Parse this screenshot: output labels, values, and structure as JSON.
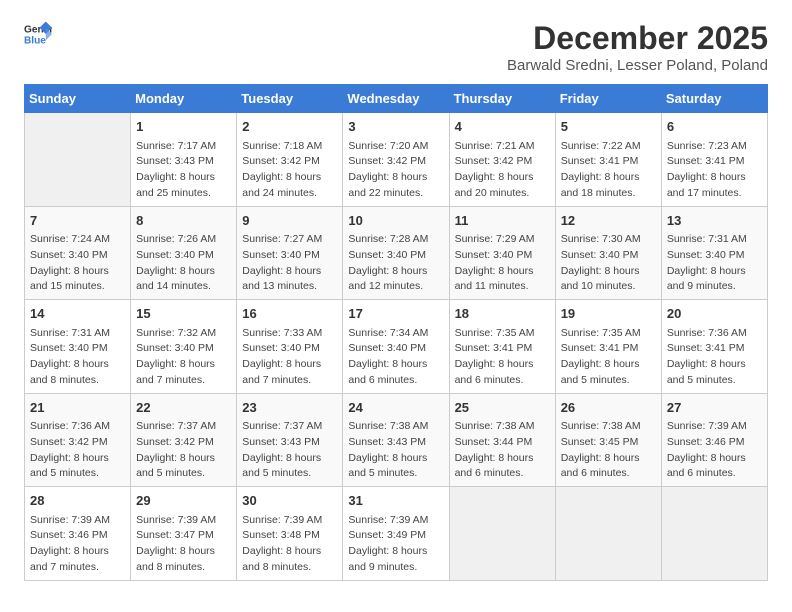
{
  "header": {
    "logo_general": "General",
    "logo_blue": "Blue",
    "title": "December 2025",
    "subtitle": "Barwald Sredni, Lesser Poland, Poland"
  },
  "weekdays": [
    "Sunday",
    "Monday",
    "Tuesday",
    "Wednesday",
    "Thursday",
    "Friday",
    "Saturday"
  ],
  "weeks": [
    [
      {
        "day": "",
        "sunrise": "",
        "sunset": "",
        "daylight": ""
      },
      {
        "day": "1",
        "sunrise": "Sunrise: 7:17 AM",
        "sunset": "Sunset: 3:43 PM",
        "daylight": "Daylight: 8 hours and 25 minutes."
      },
      {
        "day": "2",
        "sunrise": "Sunrise: 7:18 AM",
        "sunset": "Sunset: 3:42 PM",
        "daylight": "Daylight: 8 hours and 24 minutes."
      },
      {
        "day": "3",
        "sunrise": "Sunrise: 7:20 AM",
        "sunset": "Sunset: 3:42 PM",
        "daylight": "Daylight: 8 hours and 22 minutes."
      },
      {
        "day": "4",
        "sunrise": "Sunrise: 7:21 AM",
        "sunset": "Sunset: 3:42 PM",
        "daylight": "Daylight: 8 hours and 20 minutes."
      },
      {
        "day": "5",
        "sunrise": "Sunrise: 7:22 AM",
        "sunset": "Sunset: 3:41 PM",
        "daylight": "Daylight: 8 hours and 18 minutes."
      },
      {
        "day": "6",
        "sunrise": "Sunrise: 7:23 AM",
        "sunset": "Sunset: 3:41 PM",
        "daylight": "Daylight: 8 hours and 17 minutes."
      }
    ],
    [
      {
        "day": "7",
        "sunrise": "Sunrise: 7:24 AM",
        "sunset": "Sunset: 3:40 PM",
        "daylight": "Daylight: 8 hours and 15 minutes."
      },
      {
        "day": "8",
        "sunrise": "Sunrise: 7:26 AM",
        "sunset": "Sunset: 3:40 PM",
        "daylight": "Daylight: 8 hours and 14 minutes."
      },
      {
        "day": "9",
        "sunrise": "Sunrise: 7:27 AM",
        "sunset": "Sunset: 3:40 PM",
        "daylight": "Daylight: 8 hours and 13 minutes."
      },
      {
        "day": "10",
        "sunrise": "Sunrise: 7:28 AM",
        "sunset": "Sunset: 3:40 PM",
        "daylight": "Daylight: 8 hours and 12 minutes."
      },
      {
        "day": "11",
        "sunrise": "Sunrise: 7:29 AM",
        "sunset": "Sunset: 3:40 PM",
        "daylight": "Daylight: 8 hours and 11 minutes."
      },
      {
        "day": "12",
        "sunrise": "Sunrise: 7:30 AM",
        "sunset": "Sunset: 3:40 PM",
        "daylight": "Daylight: 8 hours and 10 minutes."
      },
      {
        "day": "13",
        "sunrise": "Sunrise: 7:31 AM",
        "sunset": "Sunset: 3:40 PM",
        "daylight": "Daylight: 8 hours and 9 minutes."
      }
    ],
    [
      {
        "day": "14",
        "sunrise": "Sunrise: 7:31 AM",
        "sunset": "Sunset: 3:40 PM",
        "daylight": "Daylight: 8 hours and 8 minutes."
      },
      {
        "day": "15",
        "sunrise": "Sunrise: 7:32 AM",
        "sunset": "Sunset: 3:40 PM",
        "daylight": "Daylight: 8 hours and 7 minutes."
      },
      {
        "day": "16",
        "sunrise": "Sunrise: 7:33 AM",
        "sunset": "Sunset: 3:40 PM",
        "daylight": "Daylight: 8 hours and 7 minutes."
      },
      {
        "day": "17",
        "sunrise": "Sunrise: 7:34 AM",
        "sunset": "Sunset: 3:40 PM",
        "daylight": "Daylight: 8 hours and 6 minutes."
      },
      {
        "day": "18",
        "sunrise": "Sunrise: 7:35 AM",
        "sunset": "Sunset: 3:41 PM",
        "daylight": "Daylight: 8 hours and 6 minutes."
      },
      {
        "day": "19",
        "sunrise": "Sunrise: 7:35 AM",
        "sunset": "Sunset: 3:41 PM",
        "daylight": "Daylight: 8 hours and 5 minutes."
      },
      {
        "day": "20",
        "sunrise": "Sunrise: 7:36 AM",
        "sunset": "Sunset: 3:41 PM",
        "daylight": "Daylight: 8 hours and 5 minutes."
      }
    ],
    [
      {
        "day": "21",
        "sunrise": "Sunrise: 7:36 AM",
        "sunset": "Sunset: 3:42 PM",
        "daylight": "Daylight: 8 hours and 5 minutes."
      },
      {
        "day": "22",
        "sunrise": "Sunrise: 7:37 AM",
        "sunset": "Sunset: 3:42 PM",
        "daylight": "Daylight: 8 hours and 5 minutes."
      },
      {
        "day": "23",
        "sunrise": "Sunrise: 7:37 AM",
        "sunset": "Sunset: 3:43 PM",
        "daylight": "Daylight: 8 hours and 5 minutes."
      },
      {
        "day": "24",
        "sunrise": "Sunrise: 7:38 AM",
        "sunset": "Sunset: 3:43 PM",
        "daylight": "Daylight: 8 hours and 5 minutes."
      },
      {
        "day": "25",
        "sunrise": "Sunrise: 7:38 AM",
        "sunset": "Sunset: 3:44 PM",
        "daylight": "Daylight: 8 hours and 6 minutes."
      },
      {
        "day": "26",
        "sunrise": "Sunrise: 7:38 AM",
        "sunset": "Sunset: 3:45 PM",
        "daylight": "Daylight: 8 hours and 6 minutes."
      },
      {
        "day": "27",
        "sunrise": "Sunrise: 7:39 AM",
        "sunset": "Sunset: 3:46 PM",
        "daylight": "Daylight: 8 hours and 6 minutes."
      }
    ],
    [
      {
        "day": "28",
        "sunrise": "Sunrise: 7:39 AM",
        "sunset": "Sunset: 3:46 PM",
        "daylight": "Daylight: 8 hours and 7 minutes."
      },
      {
        "day": "29",
        "sunrise": "Sunrise: 7:39 AM",
        "sunset": "Sunset: 3:47 PM",
        "daylight": "Daylight: 8 hours and 8 minutes."
      },
      {
        "day": "30",
        "sunrise": "Sunrise: 7:39 AM",
        "sunset": "Sunset: 3:48 PM",
        "daylight": "Daylight: 8 hours and 8 minutes."
      },
      {
        "day": "31",
        "sunrise": "Sunrise: 7:39 AM",
        "sunset": "Sunset: 3:49 PM",
        "daylight": "Daylight: 8 hours and 9 minutes."
      },
      {
        "day": "",
        "sunrise": "",
        "sunset": "",
        "daylight": ""
      },
      {
        "day": "",
        "sunrise": "",
        "sunset": "",
        "daylight": ""
      },
      {
        "day": "",
        "sunrise": "",
        "sunset": "",
        "daylight": ""
      }
    ]
  ]
}
